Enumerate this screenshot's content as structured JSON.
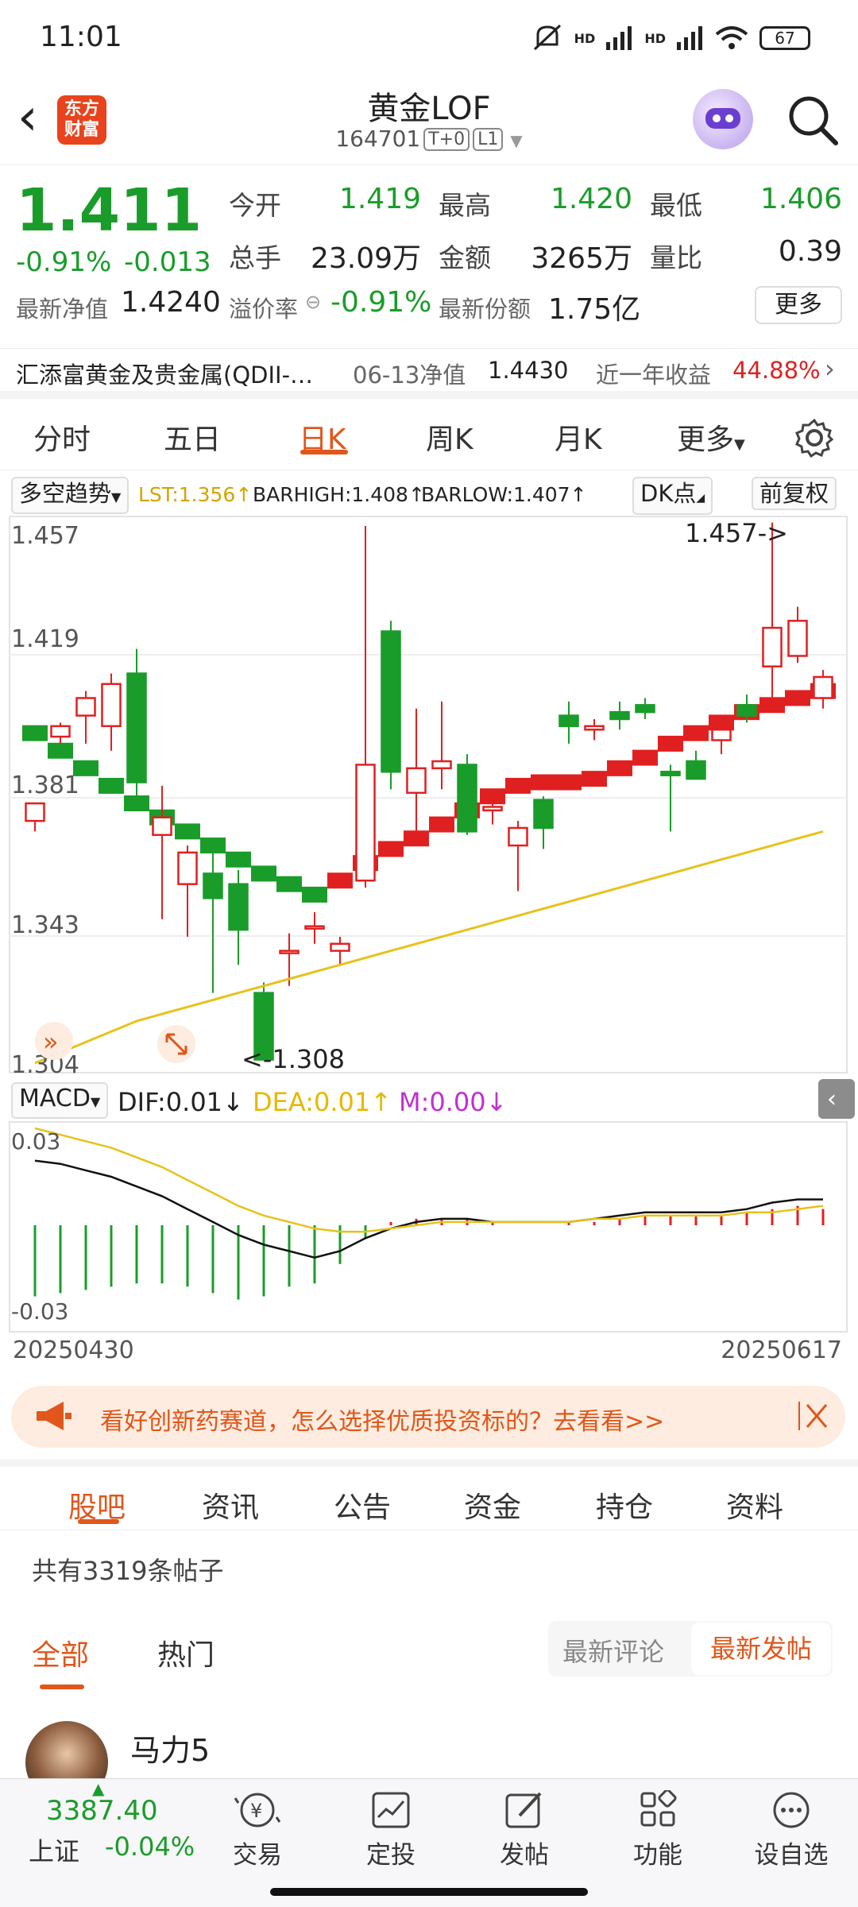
{
  "status_bar": {
    "time": "11:01",
    "signal1": "HD",
    "signal2": "HD",
    "battery": "67"
  },
  "header": {
    "title": "黄金LOF",
    "code": "164701",
    "tag1": "T+0",
    "tag2": "L1",
    "logo_line1": "东方",
    "logo_line2": "财富"
  },
  "quote": {
    "price": "1.411",
    "change_pct": "-0.91%",
    "change": "-0.013",
    "open_label": "今开",
    "open": "1.419",
    "high_label": "最高",
    "high": "1.420",
    "low_label": "最低",
    "low": "1.406",
    "volume_label": "总手",
    "volume": "23.09万",
    "amount_label": "金额",
    "amount": "3265万",
    "vol_ratio_label": "量比",
    "vol_ratio": "0.39",
    "nav_label": "最新净值",
    "nav": "1.4240",
    "premium_label": "溢价率",
    "premium": "-0.91%",
    "shares_label": "最新份额",
    "shares": "1.75亿",
    "more": "更多"
  },
  "fund_row": {
    "name": "汇添富黄金及贵金属(QDII-…",
    "nav_date_label": "06-13净值",
    "nav_value": "1.4430",
    "year_return_label": "近一年收益",
    "year_return": "44.88%"
  },
  "period_tabs": [
    "分时",
    "五日",
    "日K",
    "周K",
    "月K",
    "更多"
  ],
  "indicator_row": {
    "strategy": "多空趋势",
    "lst": "LST:1.356",
    "barhigh": "BARHIGH:1.408",
    "barlow": "BARLOW:1.407",
    "dk_button": "DK点",
    "adjust_button": "前复权"
  },
  "chart_data": {
    "type": "candlestick",
    "y_ticks": [
      "1.457",
      "1.419",
      "1.381",
      "1.343",
      "1.304"
    ],
    "ylim": [
      1.304,
      1.457
    ],
    "annot_high": "1.457->",
    "annot_low": "<-1.308",
    "candles": [
      {
        "o": 1.373,
        "c": 1.378,
        "h": 1.378,
        "l": 1.37
      },
      {
        "o": 1.397,
        "c": 1.4,
        "h": 1.401,
        "l": 1.395
      },
      {
        "o": 1.403,
        "c": 1.408,
        "h": 1.41,
        "l": 1.395
      },
      {
        "o": 1.4,
        "c": 1.412,
        "h": 1.415,
        "l": 1.393
      },
      {
        "o": 1.415,
        "c": 1.384,
        "h": 1.422,
        "l": 1.38
      },
      {
        "o": 1.369,
        "c": 1.374,
        "h": 1.383,
        "l": 1.345
      },
      {
        "o": 1.355,
        "c": 1.364,
        "h": 1.366,
        "l": 1.34
      },
      {
        "o": 1.358,
        "c": 1.351,
        "h": 1.366,
        "l": 1.324
      },
      {
        "o": 1.355,
        "c": 1.342,
        "h": 1.359,
        "l": 1.332
      },
      {
        "o": 1.324,
        "c": 1.305,
        "h": 1.327,
        "l": 1.308
      },
      {
        "o": 1.336,
        "c": 1.336,
        "h": 1.341,
        "l": 1.326
      },
      {
        "o": 1.343,
        "c": 1.343,
        "h": 1.347,
        "l": 1.338
      },
      {
        "o": 1.336,
        "c": 1.338,
        "h": 1.34,
        "l": 1.332
      },
      {
        "o": 1.356,
        "c": 1.389,
        "h": 1.457,
        "l": 1.354
      },
      {
        "o": 1.427,
        "c": 1.387,
        "h": 1.43,
        "l": 1.382
      },
      {
        "o": 1.381,
        "c": 1.388,
        "h": 1.405,
        "l": 1.366
      },
      {
        "o": 1.388,
        "c": 1.39,
        "h": 1.407,
        "l": 1.382
      },
      {
        "o": 1.389,
        "c": 1.37,
        "h": 1.392,
        "l": 1.369
      },
      {
        "o": 1.376,
        "c": 1.377,
        "h": 1.38,
        "l": 1.372
      },
      {
        "o": 1.366,
        "c": 1.371,
        "h": 1.373,
        "l": 1.353
      },
      {
        "o": 1.379,
        "c": 1.371,
        "h": 1.38,
        "l": 1.365
      },
      {
        "o": 1.403,
        "c": 1.4,
        "h": 1.407,
        "l": 1.395
      },
      {
        "o": 1.399,
        "c": 1.4,
        "h": 1.402,
        "l": 1.396
      },
      {
        "o": 1.404,
        "c": 1.402,
        "h": 1.407,
        "l": 1.399
      },
      {
        "o": 1.406,
        "c": 1.404,
        "h": 1.408,
        "l": 1.402
      },
      {
        "o": 1.387,
        "c": 1.386,
        "h": 1.389,
        "l": 1.37
      },
      {
        "o": 1.39,
        "c": 1.385,
        "h": 1.393,
        "l": 1.385
      },
      {
        "o": 1.396,
        "c": 1.399,
        "h": 1.401,
        "l": 1.392
      },
      {
        "o": 1.406,
        "c": 1.403,
        "h": 1.409,
        "l": 1.401
      },
      {
        "o": 1.417,
        "c": 1.428,
        "h": 1.458,
        "l": 1.408
      },
      {
        "o": 1.42,
        "c": 1.43,
        "h": 1.434,
        "l": 1.418
      },
      {
        "o": 1.408,
        "c": 1.414,
        "h": 1.416,
        "l": 1.405
      }
    ],
    "trend_line": [
      1.398,
      1.393,
      1.388,
      1.383,
      1.378,
      1.374,
      1.37,
      1.366,
      1.362,
      1.358,
      1.355,
      1.352,
      1.356,
      1.361,
      1.365,
      1.368,
      1.372,
      1.376,
      1.38,
      1.383,
      1.384,
      1.384,
      1.385,
      1.388,
      1.391,
      1.395,
      1.398,
      1.401,
      1.404,
      1.406,
      1.408,
      1.41
    ],
    "ma_line": [
      1.304,
      1.307,
      1.31,
      1.313,
      1.316,
      1.318,
      1.32,
      1.322,
      1.324,
      1.326,
      1.328,
      1.33,
      1.332,
      1.334,
      1.336,
      1.338,
      1.34,
      1.342,
      1.344,
      1.346,
      1.348,
      1.35,
      1.352,
      1.354,
      1.356,
      1.358,
      1.36,
      1.362,
      1.364,
      1.366,
      1.368,
      1.37
    ]
  },
  "macd": {
    "label": "MACD",
    "dif": "DIF:0.01",
    "dea": "DEA:0.01",
    "m": "M:0.00",
    "y_top": "0.03",
    "y_bottom": "-0.03",
    "dif_line": [
      0.02,
      0.019,
      0.017,
      0.015,
      0.012,
      0.009,
      0.005,
      0.001,
      -0.003,
      -0.006,
      -0.008,
      -0.01,
      -0.008,
      -0.004,
      -0.001,
      0.001,
      0.002,
      0.002,
      0.001,
      0.001,
      0.001,
      0.001,
      0.002,
      0.003,
      0.004,
      0.004,
      0.004,
      0.004,
      0.005,
      0.007,
      0.008,
      0.008
    ],
    "dea_line": [
      0.03,
      0.028,
      0.026,
      0.024,
      0.021,
      0.018,
      0.014,
      0.01,
      0.006,
      0.003,
      0.001,
      -0.001,
      -0.002,
      -0.002,
      -0.001,
      0.0,
      0.001,
      0.001,
      0.001,
      0.001,
      0.001,
      0.001,
      0.002,
      0.002,
      0.003,
      0.003,
      0.003,
      0.003,
      0.004,
      0.004,
      0.005,
      0.006
    ],
    "hist": [
      -0.022,
      -0.021,
      -0.02,
      -0.019,
      -0.018,
      -0.018,
      -0.019,
      -0.021,
      -0.023,
      -0.022,
      -0.019,
      -0.018,
      -0.012,
      -0.004,
      0.001,
      0.002,
      0.002,
      0.002,
      0.001,
      0.0,
      0.0,
      0.001,
      0.001,
      0.002,
      0.003,
      0.003,
      0.003,
      0.003,
      0.004,
      0.005,
      0.006,
      0.005
    ]
  },
  "dates": {
    "start": "20250430",
    "end": "20250617"
  },
  "ad": {
    "text": "看好创新药赛道，怎么选择优质投资标的？去看看>>"
  },
  "community_tabs": [
    "股吧",
    "资讯",
    "公告",
    "资金",
    "持仓",
    "资料"
  ],
  "post_count": "共有3319条帖子",
  "filters": {
    "all": "全部",
    "hot": "热门",
    "latest_comment": "最新评论",
    "latest_post": "最新发帖"
  },
  "post": {
    "author": "马力5"
  },
  "bottom_nav": {
    "index_value": "3387.40",
    "index_name": "上证",
    "index_change": "-0.04%",
    "items": [
      "交易",
      "定投",
      "发帖",
      "功能",
      "设自选"
    ]
  },
  "colors": {
    "up": "#e02020",
    "down": "#1a9c2a",
    "accent": "#e0561b",
    "ma": "#e6c21c"
  }
}
